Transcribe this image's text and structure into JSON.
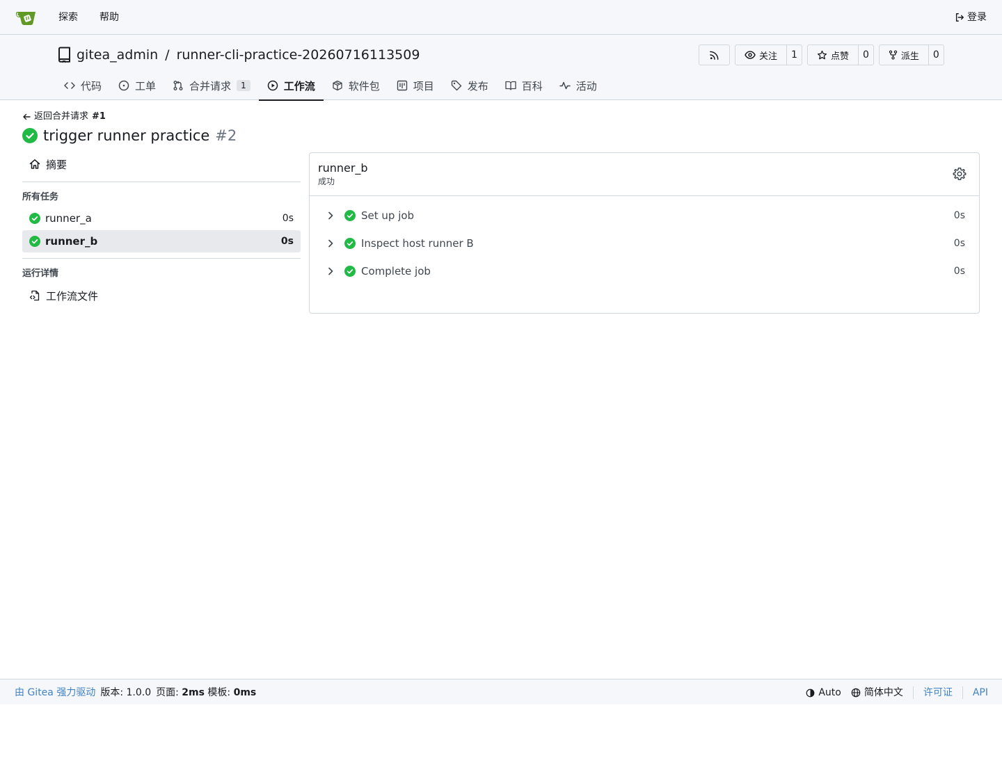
{
  "navbar": {
    "explore": "探索",
    "help": "帮助",
    "login": "登录"
  },
  "repo": {
    "owner": "gitea_admin",
    "separator": "/",
    "name": "runner-cli-practice-20260716113509",
    "watch_label": "关注",
    "watch_count": "1",
    "star_label": "点赞",
    "star_count": "0",
    "fork_label": "派生",
    "fork_count": "0"
  },
  "tabs": [
    {
      "label": "代码",
      "icon": "code-icon"
    },
    {
      "label": "工单",
      "icon": "issue-icon"
    },
    {
      "label": "合并请求",
      "icon": "pull-request-icon",
      "badge": "1"
    },
    {
      "label": "工作流",
      "icon": "play-icon",
      "active": true
    },
    {
      "label": "软件包",
      "icon": "package-icon"
    },
    {
      "label": "项目",
      "icon": "project-icon"
    },
    {
      "label": "发布",
      "icon": "tag-icon"
    },
    {
      "label": "百科",
      "icon": "book-icon"
    },
    {
      "label": "活动",
      "icon": "pulse-icon"
    }
  ],
  "run": {
    "back_text": "返回合并请求",
    "back_ref": "#1",
    "title": "trigger runner practice",
    "number": "#2"
  },
  "sidebar": {
    "summary": "摘要",
    "all_jobs_heading": "所有任务",
    "jobs": [
      {
        "name": "runner_a",
        "duration": "0s",
        "status": "success"
      },
      {
        "name": "runner_b",
        "duration": "0s",
        "status": "success",
        "active": true
      }
    ],
    "run_details_heading": "运行详情",
    "workflow_file": "工作流文件"
  },
  "job": {
    "name": "runner_b",
    "status_text": "成功",
    "steps": [
      {
        "name": "Set up job",
        "duration": "0s"
      },
      {
        "name": "Inspect host runner B",
        "duration": "0s"
      },
      {
        "name": "Complete job",
        "duration": "0s"
      }
    ]
  },
  "footer": {
    "powered_by": "由 Gitea 强力驱动",
    "version_label": "版本:",
    "version": "1.0.0",
    "page_label": "页面:",
    "page_time": "2ms",
    "template_label": "模板:",
    "template_time": "0ms",
    "theme": "Auto",
    "language": "简体中文",
    "license": "许可证",
    "api": "API"
  },
  "colors": {
    "success": "#21ba45",
    "link": "#4183c4",
    "border": "#d0d7de",
    "header_bg": "#f6f7fa",
    "logo": "#609926"
  }
}
